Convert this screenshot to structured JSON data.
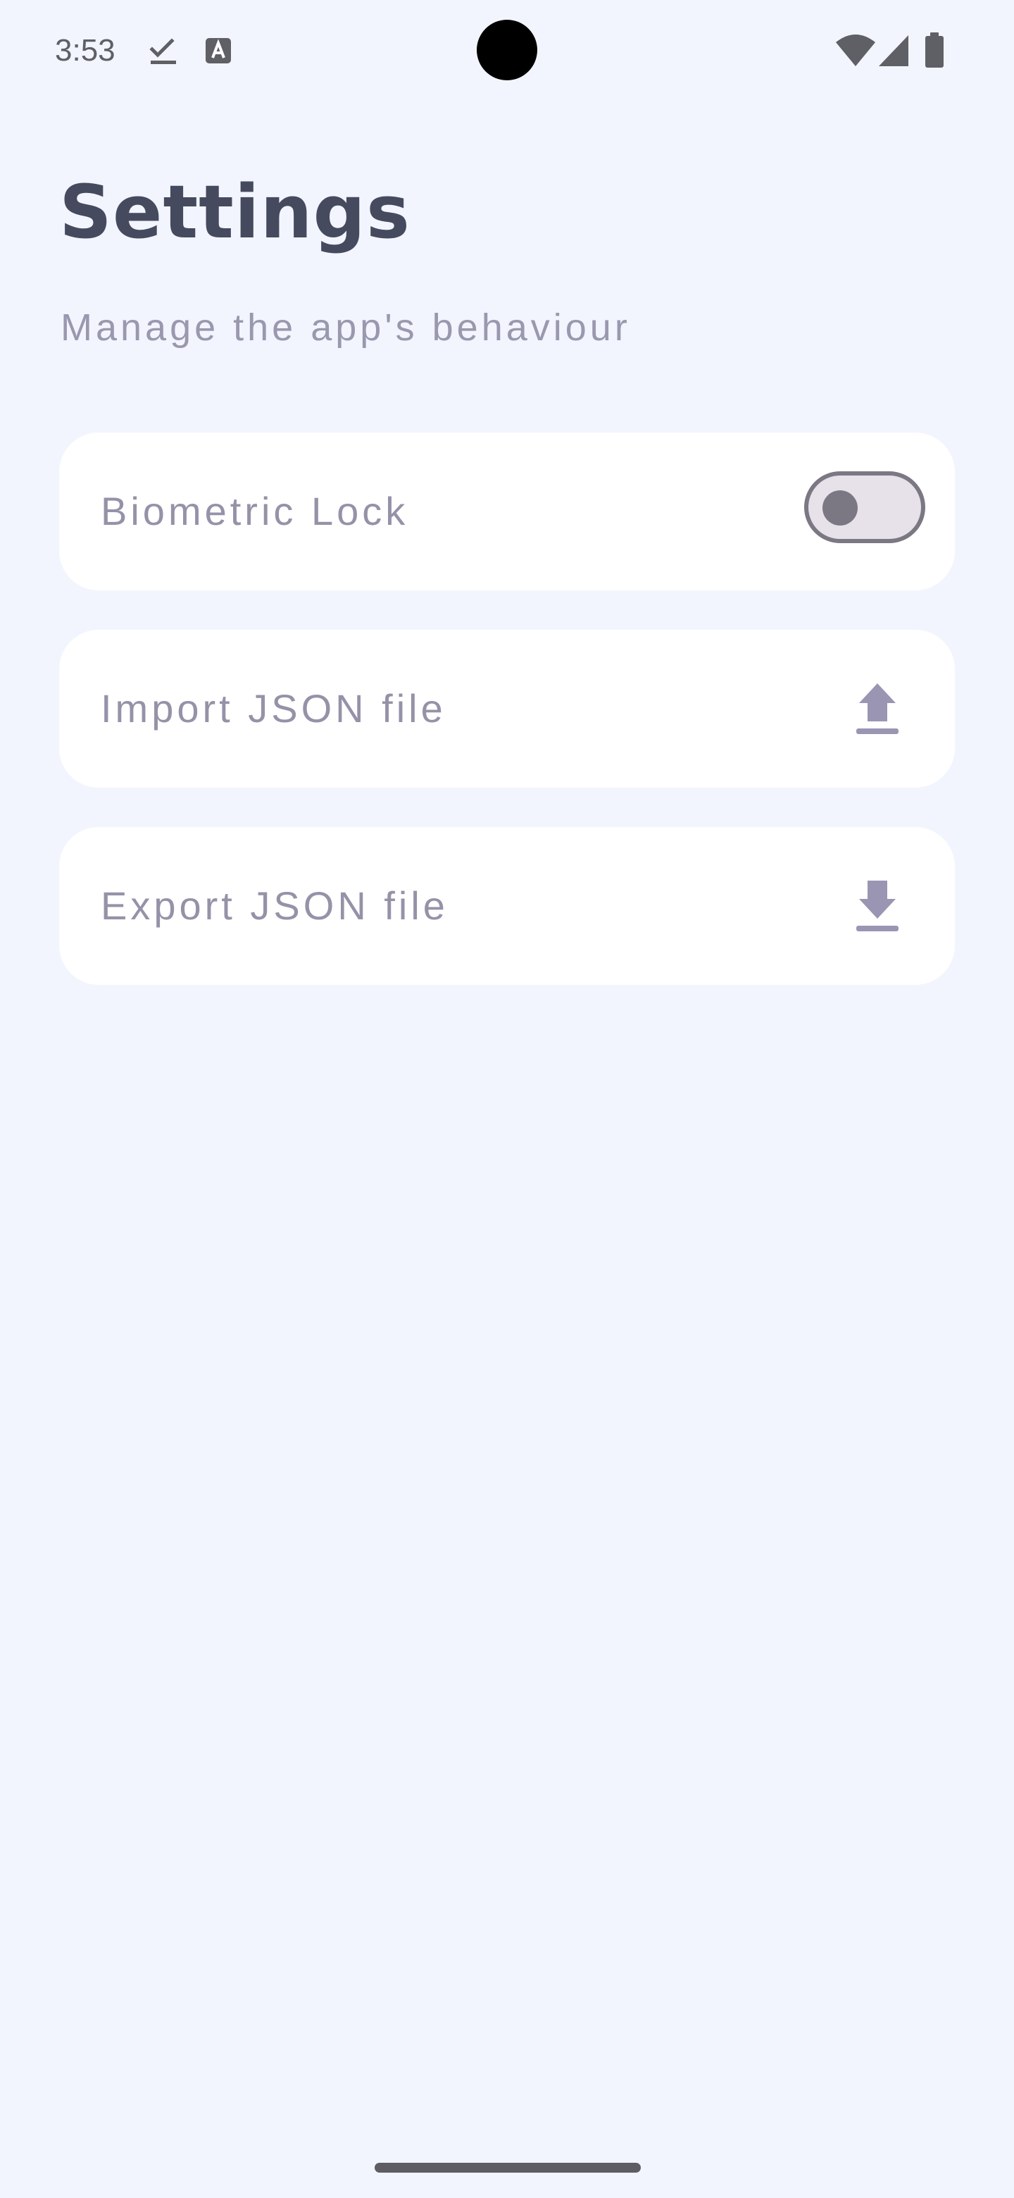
{
  "status_bar": {
    "time": "3:53",
    "icons": [
      "check-notification-icon",
      "text-a-notification-icon",
      "wifi-icon",
      "cellular-signal-icon",
      "battery-icon"
    ]
  },
  "header": {
    "title": "Settings",
    "subtitle": "Manage the app's behaviour"
  },
  "settings": {
    "biometric": {
      "label": "Biometric Lock",
      "enabled": false
    },
    "import": {
      "label": "Import JSON file",
      "icon": "upload-icon"
    },
    "export": {
      "label": "Export JSON file",
      "icon": "download-icon"
    }
  },
  "colors": {
    "background": "#f2f5fd",
    "card": "#ffffff",
    "title": "#464a5e",
    "muted_text": "#9592a8",
    "icon_accent": "#9b95b4",
    "toggle_outline": "#7c7883",
    "toggle_track": "#e7e1ea"
  }
}
